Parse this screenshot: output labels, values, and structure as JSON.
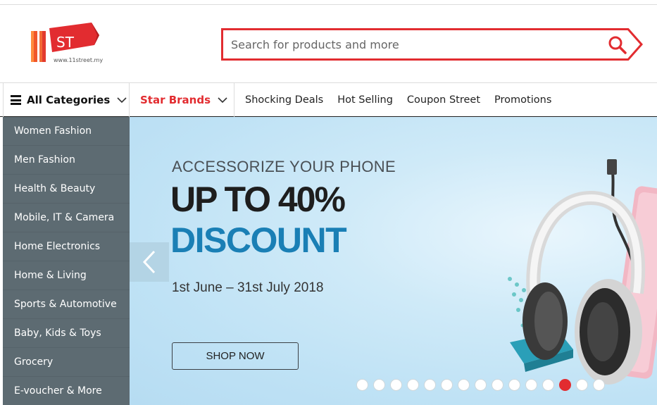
{
  "header": {
    "logo_url_text": "www.11street.my",
    "logo_text": "ST",
    "search_placeholder": "Search for products and more"
  },
  "nav": {
    "all_categories_label": "All Categories",
    "star_brands_label": "Star Brands",
    "links": [
      "Shocking Deals",
      "Hot Selling",
      "Coupon Street",
      "Promotions"
    ]
  },
  "sidebar": {
    "items": [
      {
        "label": "Women Fashion"
      },
      {
        "label": "Men Fashion"
      },
      {
        "label": "Health & Beauty"
      },
      {
        "label": "Mobile, IT & Camera"
      },
      {
        "label": "Home Electronics"
      },
      {
        "label": "Home & Living"
      },
      {
        "label": "Sports & Automotive"
      },
      {
        "label": "Baby, Kids & Toys"
      },
      {
        "label": "Grocery"
      },
      {
        "label": "E-voucher & More"
      }
    ]
  },
  "banner": {
    "eyebrow": "ACCESSORIZE YOUR PHONE",
    "headline": "UP TO 40%",
    "discount": "DISCOUNT",
    "date_range": "1st June – 31st July 2018",
    "cta_label": "SHOP NOW",
    "slide_count": 15,
    "active_slide": 13
  },
  "colors": {
    "brand_red": "#e22c30",
    "sidebar_bg": "#5d6b72",
    "discount_blue": "#1a7fb5"
  },
  "icons": {
    "menu": "hamburger-icon",
    "dropdown": "chevron-down-icon",
    "search": "search-icon",
    "prev": "chevron-left-icon"
  }
}
